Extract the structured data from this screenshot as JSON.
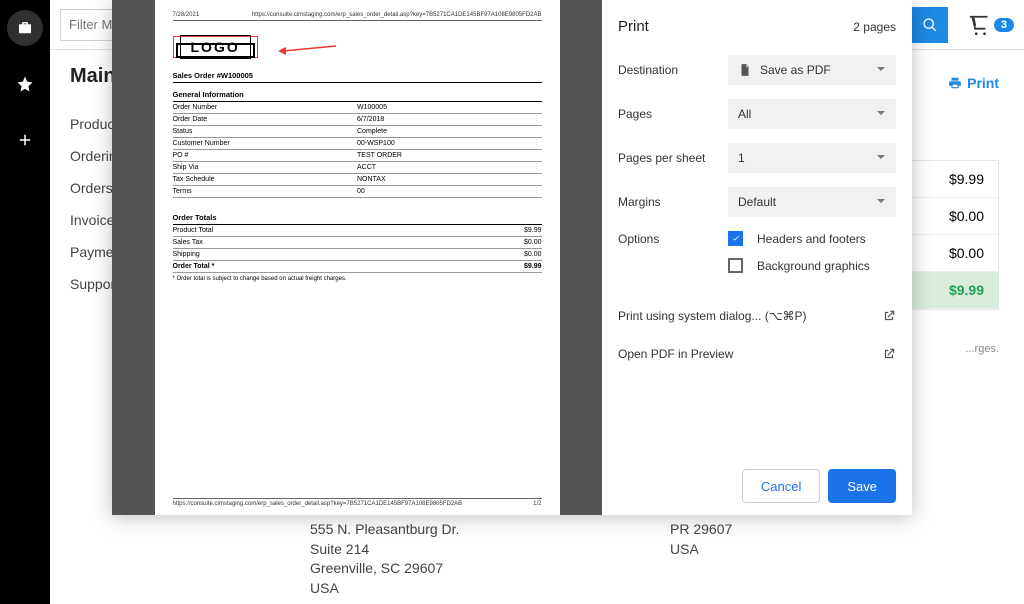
{
  "topbar": {
    "filter_placeholder": "Filter Menu",
    "cart_count": "3"
  },
  "sidenav": {
    "title": "Main",
    "items": [
      "Products",
      "Ordering",
      "Orders",
      "Invoices",
      "Payments",
      "Support"
    ]
  },
  "page": {
    "print_label": "Print",
    "totals": {
      "r1": "$9.99",
      "r2": "$0.00",
      "r3": "$0.00",
      "total": "$9.99"
    },
    "totals_note_fragment": "...rges."
  },
  "addresses": {
    "a": {
      "line1": "555 N. Pleasantburg Dr.",
      "line2": "Suite 214",
      "line3": "Greenville, SC 29607",
      "line4": "USA"
    },
    "b": {
      "line1": "PR 29607",
      "line2": "USA"
    }
  },
  "print_dialog": {
    "title": "Print",
    "page_count": "2 pages",
    "labels": {
      "destination": "Destination",
      "pages": "Pages",
      "per_sheet": "Pages per sheet",
      "margins": "Margins",
      "options": "Options"
    },
    "values": {
      "destination": "Save as PDF",
      "pages": "All",
      "per_sheet": "1",
      "margins": "Default"
    },
    "options": {
      "headers_footers": "Headers and footers",
      "background": "Background graphics"
    },
    "links": {
      "system_dialog": "Print using system dialog... (⌥⌘P)",
      "open_pdf": "Open PDF in Preview"
    },
    "buttons": {
      "cancel": "Cancel",
      "save": "Save"
    }
  },
  "preview": {
    "header_date": "7/28/2021",
    "header_url": "https://consuite.cimstaging.com/erp_sales_order_detail.asp?key=7B5271CA1DE145BF97A108E9805FD2AB",
    "footer_url": "https://consuite.cimstaging.com/erp_sales_order_detail.asp?key=7B5271CA1DE145BF97A108E9805FD2AB",
    "footer_pg": "1/2",
    "logo_text": "LOGO",
    "sales_order_title": "Sales Order #W100005",
    "general_info": "General Information",
    "fields": [
      {
        "label": "Order Number",
        "value": "W100005"
      },
      {
        "label": "Order Date",
        "value": "6/7/2018"
      },
      {
        "label": "Status",
        "value": "Complete"
      },
      {
        "label": "Customer Number",
        "value": "00-WSP100"
      },
      {
        "label": "PO #",
        "value": "TEST ORDER"
      },
      {
        "label": "Ship Via",
        "value": "ACCT"
      },
      {
        "label": "Tax Schedule",
        "value": "NONTAX"
      },
      {
        "label": "Terms",
        "value": "00"
      }
    ],
    "order_totals_title": "Order Totals",
    "totals": [
      {
        "label": "Product Total",
        "value": "$9.99"
      },
      {
        "label": "Sales Tax",
        "value": "$0.00"
      },
      {
        "label": "Shipping",
        "value": "$0.00"
      },
      {
        "label": "Order Total *",
        "value": "$9.99",
        "bold": true
      }
    ],
    "footnote": "* Order total is subject to change based on actual freight charges."
  }
}
